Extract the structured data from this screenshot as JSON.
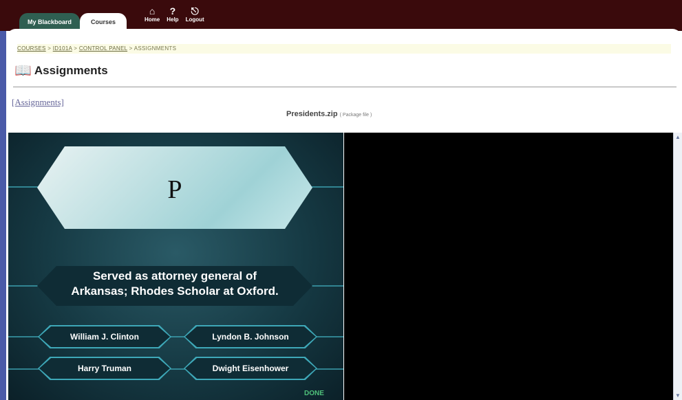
{
  "tabs": {
    "my_blackboard": "My Blackboard",
    "courses": "Courses"
  },
  "top_icons": [
    {
      "label": "Home",
      "icon": "home-icon"
    },
    {
      "label": "Help",
      "icon": "help-icon"
    },
    {
      "label": "Logout",
      "icon": "logout-icon"
    }
  ],
  "breadcrumb": {
    "courses": "COURSES",
    "course": "ID101A",
    "control_panel": "CONTROL PANEL",
    "current": "ASSIGNMENTS",
    "sep": ">"
  },
  "page_title": "Assignments",
  "assignments_link": "[Assignments]",
  "file": {
    "name": "Presidents.zip",
    "type": "( Package file )"
  },
  "game": {
    "letter": "P",
    "question_line1": "Served as attorney general of",
    "question_line2": "Arkansas; Rhodes Scholar at Oxford.",
    "answers": [
      "William J. Clinton",
      "Lyndon B. Johnson",
      "Harry Truman",
      "Dwight Eisenhower"
    ],
    "done": "DONE"
  },
  "colors": {
    "topbar": "#3a0a0c",
    "tab_active_bg": "#2f5f52",
    "game_bg": "#163a44",
    "accent": "#3ea8b8"
  }
}
